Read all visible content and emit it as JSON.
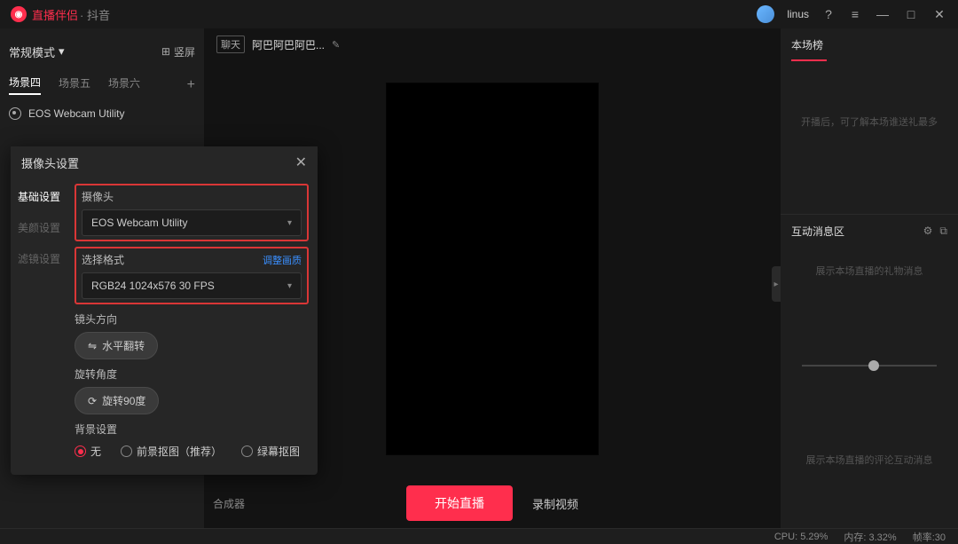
{
  "titlebar": {
    "app_name": "直播伴侣",
    "app_suffix": " · 抖音",
    "user": "linus"
  },
  "left": {
    "mode_label": "常规模式",
    "vertical_label": "竖屏",
    "scene_tabs": [
      "场景四",
      "场景五",
      "场景六"
    ],
    "active_scene": 0,
    "source_name": "EOS Webcam Utility"
  },
  "center": {
    "stream_tag": "聊天",
    "stream_title": "阿巴阿巴阿巴...",
    "compositor_label": "合成器",
    "start_button": "开始直播",
    "record_button": "录制视频"
  },
  "right": {
    "ranking_title": "本场榜",
    "ranking_hint": "开播后，可了解本场谁送礼最多",
    "interact_title": "互动消息区",
    "gift_hint": "展示本场直播的礼物消息",
    "comment_hint": "展示本场直播的评论互动消息"
  },
  "dialog": {
    "title": "摄像头设置",
    "tabs": [
      "基础设置",
      "美颜设置",
      "滤镜设置"
    ],
    "active_tab": 0,
    "camera_label": "摄像头",
    "camera_value": "EOS Webcam Utility",
    "format_label": "选择格式",
    "format_link": "调整画质",
    "format_value": "RGB24 1024x576 30 FPS",
    "mirror_label": "镜头方向",
    "mirror_button": "水平翻转",
    "rotate_label": "旋转角度",
    "rotate_button": "旋转90度",
    "bg_label": "背景设置",
    "bg_options": [
      "无",
      "前景抠图（推荐）",
      "绿幕抠图"
    ],
    "bg_selected": 0
  },
  "statusbar": {
    "cpu": "CPU: 5.29%",
    "mem": "内存: 3.32%",
    "fps": "帧率:30"
  }
}
